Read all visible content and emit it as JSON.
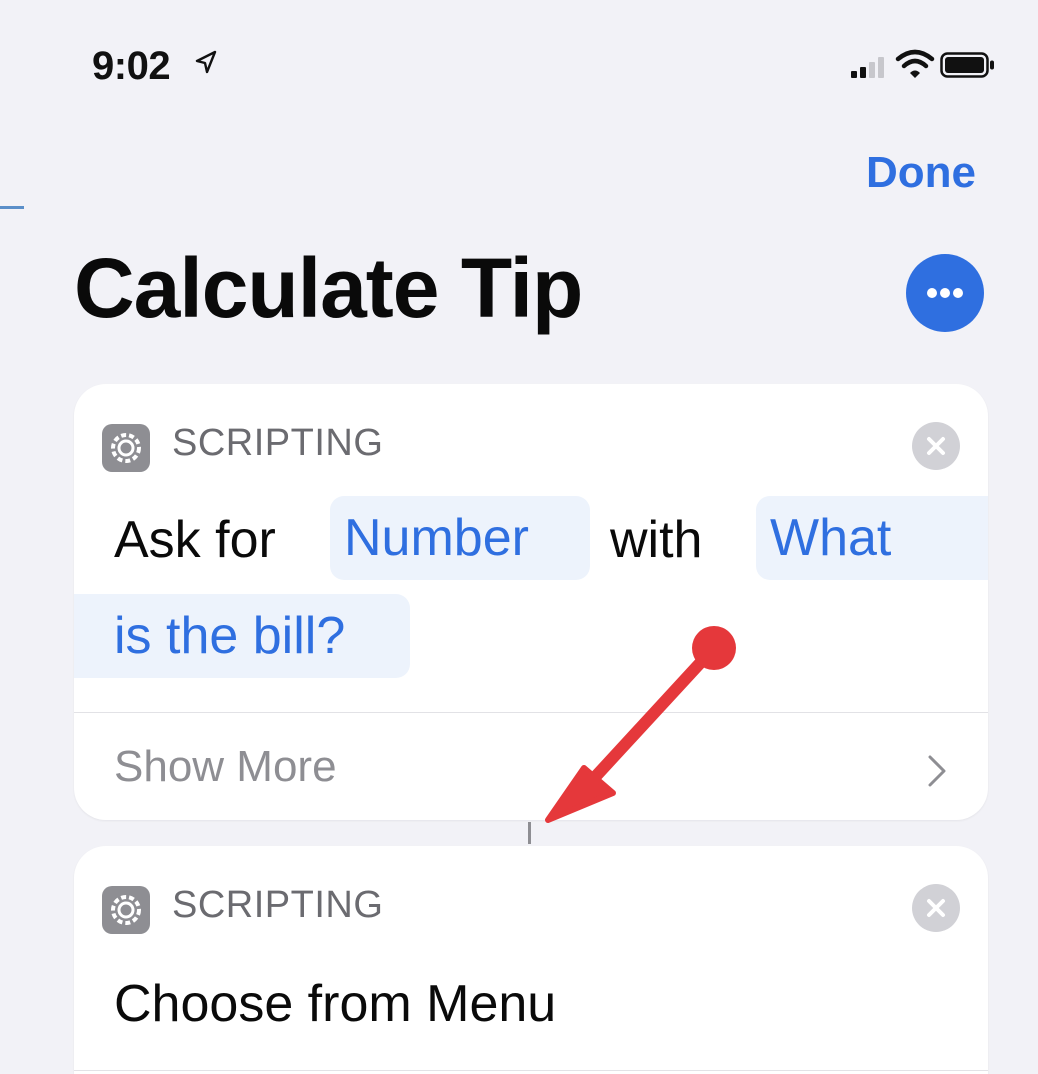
{
  "status_bar": {
    "time": "9:02"
  },
  "nav": {
    "done_label": "Done"
  },
  "title": "Calculate Tip",
  "actions": [
    {
      "category": "SCRIPTING",
      "text_ask_for": "Ask for",
      "token_number": "Number",
      "text_with": "with",
      "token_prompt_line1": "What",
      "token_prompt_line2": "is the bill?",
      "show_more_label": "Show More"
    },
    {
      "category": "SCRIPTING",
      "title": "Choose from Menu"
    }
  ],
  "colors": {
    "accent": "#2f6fe0",
    "background": "#f2f2f7",
    "token_background": "#edf3fc",
    "annotation_arrow": "#e5383b"
  }
}
